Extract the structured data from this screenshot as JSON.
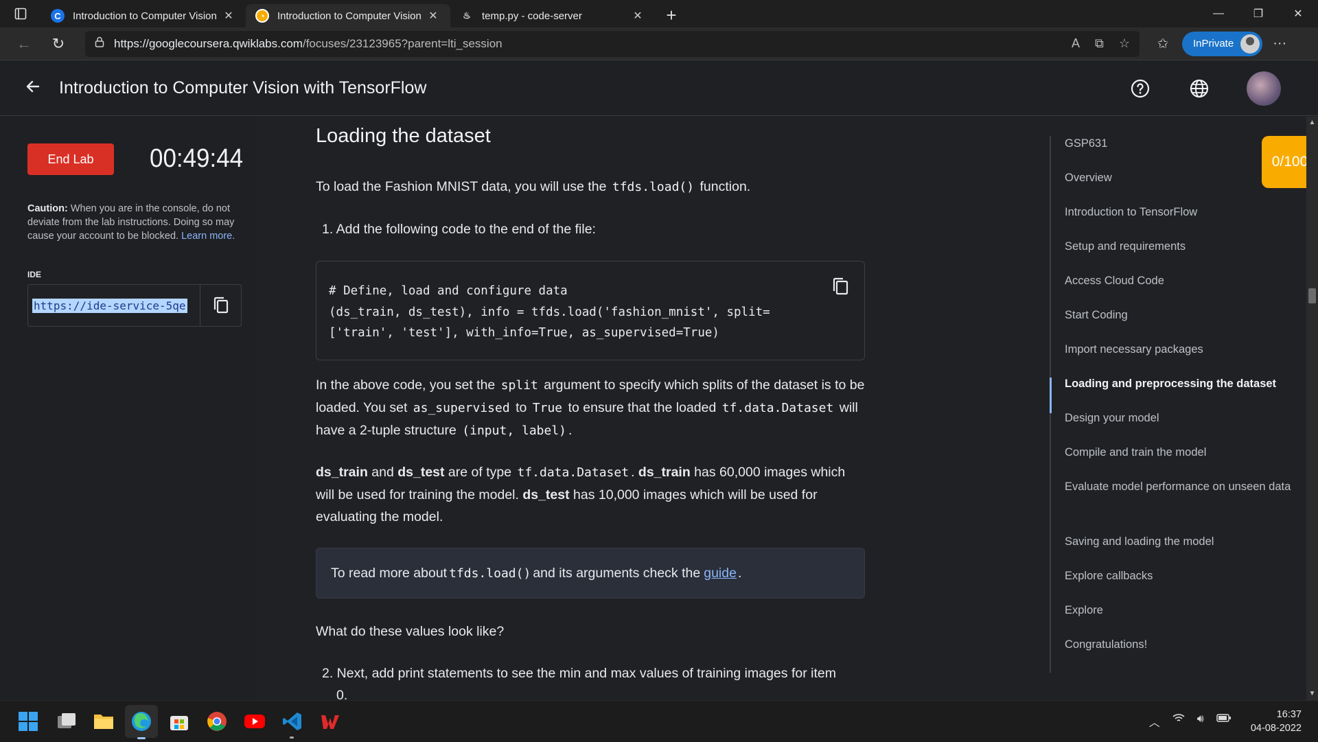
{
  "browser": {
    "tabs": [
      {
        "title": "Introduction to Computer Vision",
        "favicon": "coursera-icon",
        "color": "#1a73e8"
      },
      {
        "title": "Introduction to Computer Vision",
        "favicon": "qwiklabs-icon",
        "color": "#f9ab00"
      },
      {
        "title": "temp.py - code-server",
        "favicon": "code-server-icon",
        "color": "#cccccc"
      }
    ],
    "url_host": "https://googlecoursera.qwiklabs.com",
    "url_path": "/focuses/23123965?parent=lti_session",
    "inprivate_label": "InPrivate"
  },
  "header": {
    "title": "Introduction to Computer Vision with TensorFlow"
  },
  "lab": {
    "end_lab_label": "End Lab",
    "timer": "00:49:44",
    "caution_bold": "Caution:",
    "caution_text": " When you are in the console, do not deviate from the lab instructions. Doing so may cause your account to be blocked. ",
    "learn_more": "Learn more.",
    "ide_label": "IDE",
    "ide_url": "https://ide-service-5qe"
  },
  "content": {
    "heading": "Loading the dataset",
    "p1_a": "To load the Fashion MNIST data, you will use the ",
    "p1_code": "tfds.load()",
    "p1_b": " function.",
    "step1": "1. Add the following code to the end of the file:",
    "code": "# Define, load and configure data\n(ds_train, ds_test), info = tfds.load('fashion_mnist', split=\n['train', 'test'], with_info=True, as_supervised=True)",
    "p2_a": "In the above code, you set the ",
    "p2_code1": "split",
    "p2_b": " argument to specify which splits of the dataset is to be loaded. You set ",
    "p2_code2": "as_supervised",
    "p2_c": " to ",
    "p2_code3": "True",
    "p2_d": " to ensure that the loaded ",
    "p2_code4": "tf.data.Dataset",
    "p2_e": " will have a 2-tuple structure ",
    "p2_code5": "(input, label)",
    "p2_f": ".",
    "p3_b1": "ds_train",
    "p3_a": " and ",
    "p3_b2": "ds_test",
    "p3_c": " are of type ",
    "p3_code": "tf.data.Dataset",
    "p3_d": ". ",
    "p3_b3": "ds_train",
    "p3_e": " has 60,000 images which will be used for training the model. ",
    "p3_b4": "ds_test",
    "p3_f": " has 10,000 images which will be used for evaluating the model.",
    "info_a": "To read more about ",
    "info_code": "tfds.load()",
    "info_b": " and its arguments check the ",
    "info_link": "guide",
    "info_c": ".",
    "q": "What do these values look like?",
    "step2": "2. Next, add print statements to see the min and max values of training images for item",
    "step2_cont": "0."
  },
  "nav": {
    "items": [
      "GSP631",
      "Overview",
      "Introduction to TensorFlow",
      "Setup and requirements",
      "Access Cloud Code",
      "Start Coding",
      "Import necessary packages",
      "Loading and preprocessing the dataset",
      "Design your model",
      "Compile and train the model",
      "Evaluate model performance on unseen data",
      "Saving and loading the model",
      "Explore callbacks",
      "Explore",
      "Congratulations!"
    ],
    "active_index": 7,
    "score": "0/100"
  },
  "taskbar": {
    "apps": [
      "windows-start-icon",
      "task-view-icon",
      "file-explorer-icon",
      "edge-icon",
      "store-icon",
      "chrome-icon",
      "youtube-icon",
      "vscode-icon",
      "wps-icon"
    ],
    "time": "16:37",
    "date": "04-08-2022"
  },
  "colors": {
    "end_lab": "#d93025",
    "score_badge": "#f9ab00",
    "link": "#8ab4f8",
    "inprivate": "#1a73c8"
  }
}
